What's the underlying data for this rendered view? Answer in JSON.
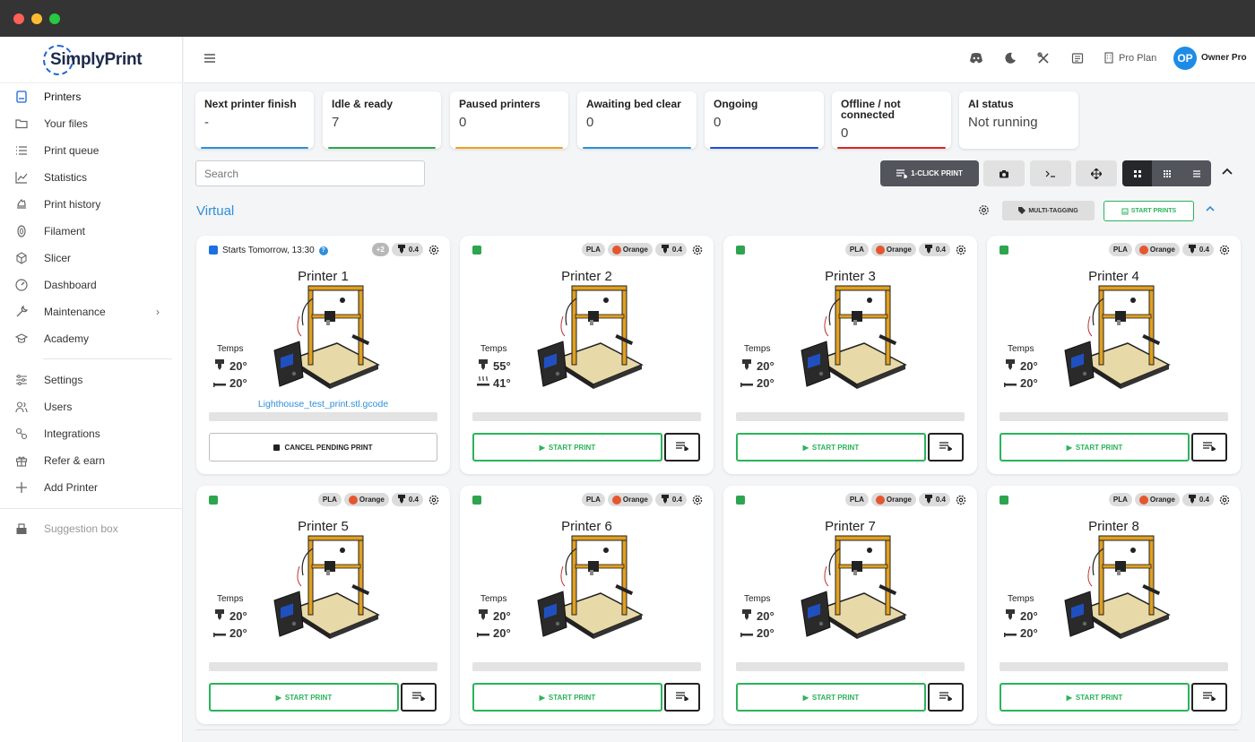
{
  "sidebar": {
    "brand": "SimplyPrint",
    "items": [
      {
        "label": "Printers",
        "icon": "printer-icon"
      },
      {
        "label": "Your files",
        "icon": "folder-icon"
      },
      {
        "label": "Print queue",
        "icon": "list-icon"
      },
      {
        "label": "Statistics",
        "icon": "chart-icon"
      },
      {
        "label": "Print history",
        "icon": "history-icon"
      },
      {
        "label": "Filament",
        "icon": "filament-icon"
      },
      {
        "label": "Slicer",
        "icon": "cube-icon"
      },
      {
        "label": "Dashboard",
        "icon": "dashboard-icon"
      },
      {
        "label": "Maintenance",
        "icon": "wrench-icon"
      },
      {
        "label": "Academy",
        "icon": "graduation-cap-icon"
      },
      {
        "label": "Settings",
        "icon": "sliders-icon"
      },
      {
        "label": "Users",
        "icon": "users-icon"
      },
      {
        "label": "Integrations",
        "icon": "integrations-icon"
      },
      {
        "label": "Refer & earn",
        "icon": "gift-icon"
      },
      {
        "label": "Add Printer",
        "icon": "plus-icon"
      },
      {
        "label": "Suggestion box",
        "icon": "suggestion-box-icon"
      }
    ]
  },
  "header": {
    "plan_label": "Pro Plan",
    "avatar_initials": "OP",
    "user_name": "Owner Pro"
  },
  "stats": [
    {
      "title": "Next printer finish",
      "value": "-",
      "color": "#2f8fd8"
    },
    {
      "title": "Idle & ready",
      "value": "7",
      "color": "#2ea44f"
    },
    {
      "title": "Paused printers",
      "value": "0",
      "color": "#f0a020"
    },
    {
      "title": "Awaiting bed clear",
      "value": "0",
      "color": "#2f8fd8"
    },
    {
      "title": "Ongoing",
      "value": "0",
      "color": "#1e4fd8"
    },
    {
      "title": "Offline / not connected",
      "value": "0",
      "color": "#e02424"
    },
    {
      "title": "AI status",
      "value": "Not running",
      "color": ""
    }
  ],
  "toolbar": {
    "search_placeholder": "Search",
    "one_click_label": "1-CLICK PRINT"
  },
  "group": {
    "title": "Virtual",
    "multi_tagging_label": "MULTI-TAGGING",
    "start_prints_label": "START PRINTS"
  },
  "temps_label": "Temps",
  "start_label": "START PRINT",
  "cancel_label": "CANCEL PENDING PRINT",
  "printers": [
    {
      "name": "Printer 1",
      "status_color": "#1e6fe0",
      "schedule": "Starts Tomorrow, 13:30",
      "extra_tag": "+2",
      "nozzle": "0.4",
      "hotend": "20°",
      "bed": "20°",
      "file": "Lighthouse_test_print.stl.gcode",
      "pending": true
    },
    {
      "name": "Printer 2",
      "status_color": "#2ea44f",
      "material": "PLA",
      "color": "Orange",
      "nozzle": "0.4",
      "hotend": "55°",
      "bed": "41°",
      "bed_heating": true
    },
    {
      "name": "Printer 3",
      "status_color": "#2ea44f",
      "material": "PLA",
      "color": "Orange",
      "nozzle": "0.4",
      "hotend": "20°",
      "bed": "20°"
    },
    {
      "name": "Printer 4",
      "status_color": "#2ea44f",
      "material": "PLA",
      "color": "Orange",
      "nozzle": "0.4",
      "hotend": "20°",
      "bed": "20°"
    },
    {
      "name": "Printer 5",
      "status_color": "#2ea44f",
      "material": "PLA",
      "color": "Orange",
      "nozzle": "0.4",
      "hotend": "20°",
      "bed": "20°"
    },
    {
      "name": "Printer 6",
      "status_color": "#2ea44f",
      "material": "PLA",
      "color": "Orange",
      "nozzle": "0.4",
      "hotend": "20°",
      "bed": "20°"
    },
    {
      "name": "Printer 7",
      "status_color": "#2ea44f",
      "material": "PLA",
      "color": "Orange",
      "nozzle": "0.4",
      "hotend": "20°",
      "bed": "20°"
    },
    {
      "name": "Printer 8",
      "status_color": "#2ea44f",
      "material": "PLA",
      "color": "Orange",
      "nozzle": "0.4",
      "hotend": "20°",
      "bed": "20°"
    }
  ]
}
